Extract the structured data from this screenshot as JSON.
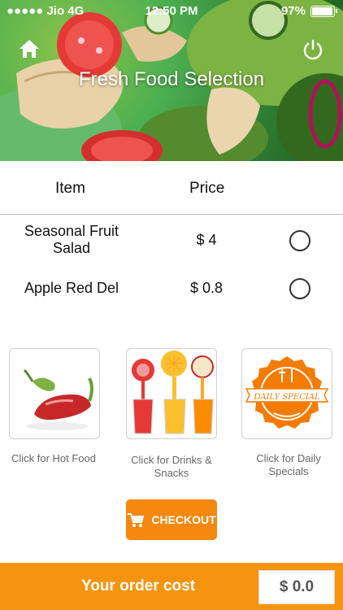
{
  "status_bar": {
    "carrier": "●●●●● Jio 4G",
    "time": "12:50 PM",
    "battery": "97%"
  },
  "header": {
    "title": "Fresh Food Selection"
  },
  "table": {
    "col_item": "Item",
    "col_price": "Price",
    "rows": [
      {
        "name": "Seasonal Fruit Salad",
        "price": "$ 4"
      },
      {
        "name": "Apple Red Del",
        "price": "$ 0.8"
      }
    ]
  },
  "categories": [
    {
      "label": "Click for Hot Food",
      "icon": "chili-pepper-icon"
    },
    {
      "label": "Click for Drinks & Snacks",
      "icon": "juice-drinks-icon"
    },
    {
      "label": "Click for Daily Specials",
      "icon": "daily-special-badge-icon"
    }
  ],
  "daily_special_badge_text": "DAILY SPECIAL",
  "checkout": {
    "label": "CHECKOUT"
  },
  "footer": {
    "label": "Your order cost",
    "total": "$ 0.0"
  },
  "colors": {
    "accent": "#f7940f",
    "checkout": "#f5880f"
  }
}
